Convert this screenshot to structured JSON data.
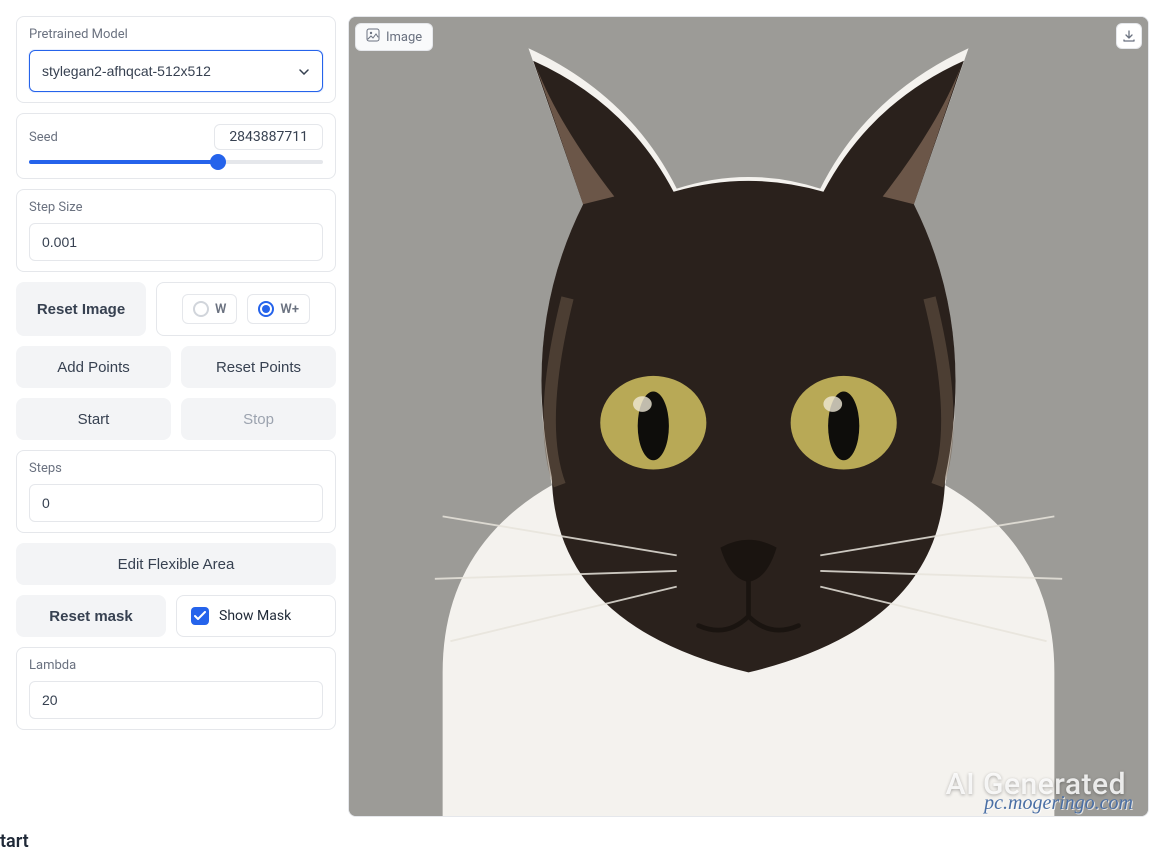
{
  "sidebar": {
    "model": {
      "label": "Pretrained Model",
      "value": "stylegan2-afhqcat-512x512"
    },
    "seed": {
      "label": "Seed",
      "value": "2843887711"
    },
    "step_size": {
      "label": "Step Size",
      "value": "0.001"
    },
    "reset_image": "Reset Image",
    "latent": {
      "w": "W",
      "wplus": "W+"
    },
    "add_points": "Add Points",
    "reset_points": "Reset Points",
    "start": "Start",
    "stop": "Stop",
    "steps": {
      "label": "Steps",
      "value": "0"
    },
    "edit_flexible": "Edit Flexible Area",
    "reset_mask": "Reset mask",
    "show_mask": "Show Mask",
    "lambda": {
      "label": "Lambda",
      "value": "20"
    }
  },
  "image_panel": {
    "label": "Image",
    "watermark": "AI Generated"
  },
  "footer": "tart",
  "site_watermark": "pc.mogeringo.com"
}
